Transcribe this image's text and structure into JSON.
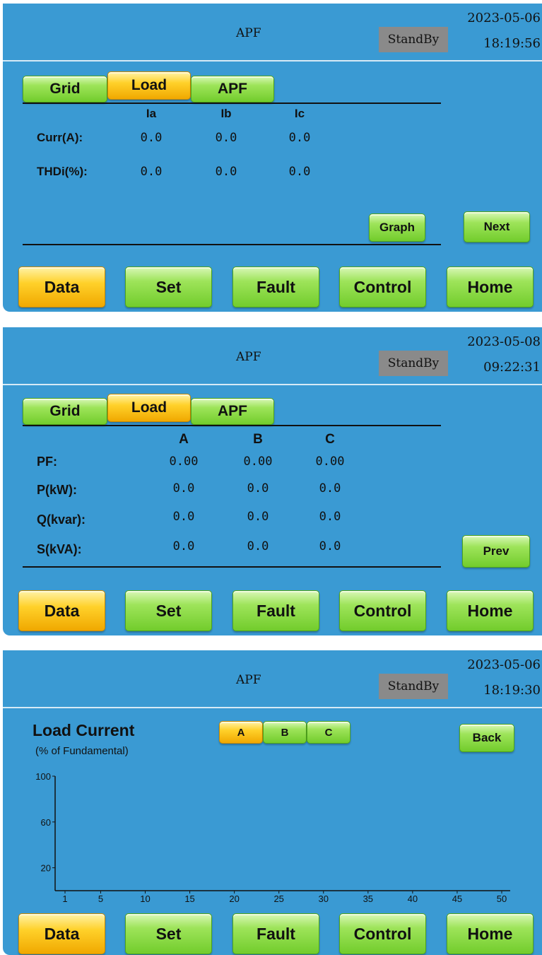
{
  "screens": [
    {
      "header": {
        "title": "APF",
        "status": "StandBy",
        "date": "2023-05-06",
        "time": "18:19:56"
      },
      "tabs": [
        {
          "label": "Grid"
        },
        {
          "label": "Load"
        },
        {
          "label": "APF"
        }
      ],
      "columns": [
        "Ia",
        "Ib",
        "Ic"
      ],
      "rows": [
        {
          "label": "Curr(A):",
          "values": [
            "0.0",
            "0.0",
            "0.0"
          ]
        },
        {
          "label": "THDi(%):",
          "values": [
            "0.0",
            "0.0",
            "0.0"
          ]
        }
      ],
      "buttons": {
        "graph": "Graph",
        "next": "Next"
      }
    },
    {
      "header": {
        "title": "APF",
        "status": "StandBy",
        "date": "2023-05-08",
        "time": "09:22:31"
      },
      "tabs": [
        {
          "label": "Grid"
        },
        {
          "label": "Load"
        },
        {
          "label": "APF"
        }
      ],
      "columns": [
        "A",
        "B",
        "C"
      ],
      "rows": [
        {
          "label": "PF:",
          "values": [
            "0.00",
            "0.00",
            "0.00"
          ]
        },
        {
          "label": "P(kW):",
          "values": [
            "0.0",
            "0.0",
            "0.0"
          ]
        },
        {
          "label": "Q(kvar):",
          "values": [
            "0.0",
            "0.0",
            "0.0"
          ]
        },
        {
          "label": "S(kVA):",
          "values": [
            "0.0",
            "0.0",
            "0.0"
          ]
        }
      ],
      "buttons": {
        "prev": "Prev"
      }
    },
    {
      "header": {
        "title": "APF",
        "status": "StandBy",
        "date": "2023-05-06",
        "time": "18:19:30"
      },
      "chart_title": "Load Current",
      "chart_subtitle": "(% of Fundamental)",
      "phases": [
        "A",
        "B",
        "C"
      ],
      "buttons": {
        "back": "Back"
      }
    }
  ],
  "nav": [
    "Data",
    "Set",
    "Fault",
    "Control",
    "Home"
  ],
  "active": {
    "tab": "Load",
    "nav": "Data",
    "phase": "A"
  },
  "colors": {
    "panel": "#3a9ad3",
    "button_green": "#8fdc48",
    "button_active": "#ffc81a",
    "status_bg": "#8a8a8a"
  },
  "chart_data": {
    "type": "bar",
    "title": "Load Current",
    "ylabel": "(% of Fundamental)",
    "ylim": [
      0,
      100
    ],
    "yticks": [
      20,
      60,
      100
    ],
    "xticks": [
      1,
      5,
      10,
      15,
      20,
      25,
      30,
      35,
      40,
      45,
      50
    ],
    "x": [],
    "values": []
  }
}
